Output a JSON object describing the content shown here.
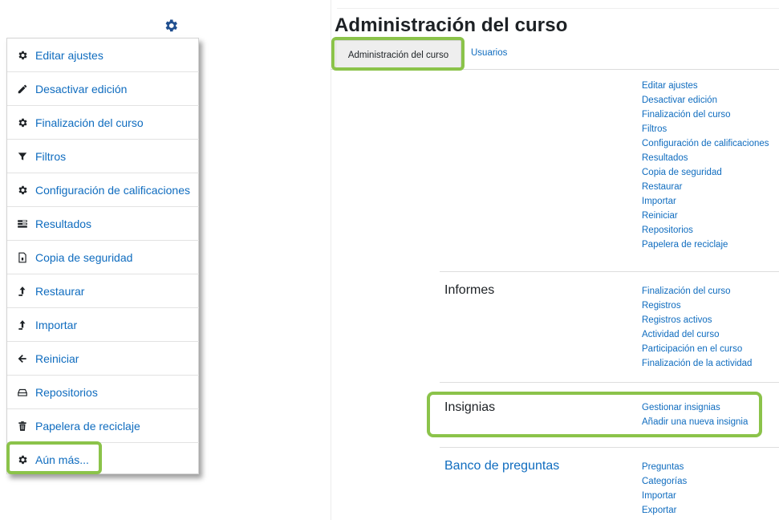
{
  "menu": {
    "items": [
      {
        "label": "Editar ajustes",
        "icon": "gear-icon"
      },
      {
        "label": "Desactivar edición",
        "icon": "pencil-icon"
      },
      {
        "label": "Finalización del curso",
        "icon": "gear-icon"
      },
      {
        "label": "Filtros",
        "icon": "filter-icon"
      },
      {
        "label": "Configuración de calificaciones",
        "icon": "gear-icon"
      },
      {
        "label": "Resultados",
        "icon": "list-icon"
      },
      {
        "label": "Copia de seguridad",
        "icon": "file-icon"
      },
      {
        "label": "Restaurar",
        "icon": "upload-arrow-icon"
      },
      {
        "label": "Importar",
        "icon": "upload-arrow-icon"
      },
      {
        "label": "Reiniciar",
        "icon": "back-arrow-icon"
      },
      {
        "label": "Repositorios",
        "icon": "drive-icon"
      },
      {
        "label": "Papelera de reciclaje",
        "icon": "trash-icon"
      },
      {
        "label": "Aún más...",
        "icon": "gear-icon"
      }
    ]
  },
  "page": {
    "title": "Administración del curso",
    "tabs": [
      "Administración del curso",
      "Usuarios"
    ]
  },
  "sections": {
    "course_admin_links": [
      "Editar ajustes",
      "Desactivar edición",
      "Finalización del curso",
      "Filtros",
      "Configuración de calificaciones",
      "Resultados",
      "Copia de seguridad",
      "Restaurar",
      "Importar",
      "Reiniciar",
      "Repositorios",
      "Papelera de reciclaje"
    ],
    "informes": {
      "title": "Informes",
      "links": [
        "Finalización del curso",
        "Registros",
        "Registros activos",
        "Actividad del curso",
        "Participación en el curso",
        "Finalización de la actividad"
      ]
    },
    "insignias": {
      "title": "Insignias",
      "links": [
        "Gestionar insignias",
        "Añadir una nueva insignia"
      ]
    },
    "banco": {
      "title": "Banco de preguntas",
      "links": [
        "Preguntas",
        "Categorías",
        "Importar",
        "Exportar"
      ]
    }
  },
  "colors": {
    "link": "#0f6cbf",
    "highlight": "#8bc34a",
    "text": "#1d2125"
  }
}
